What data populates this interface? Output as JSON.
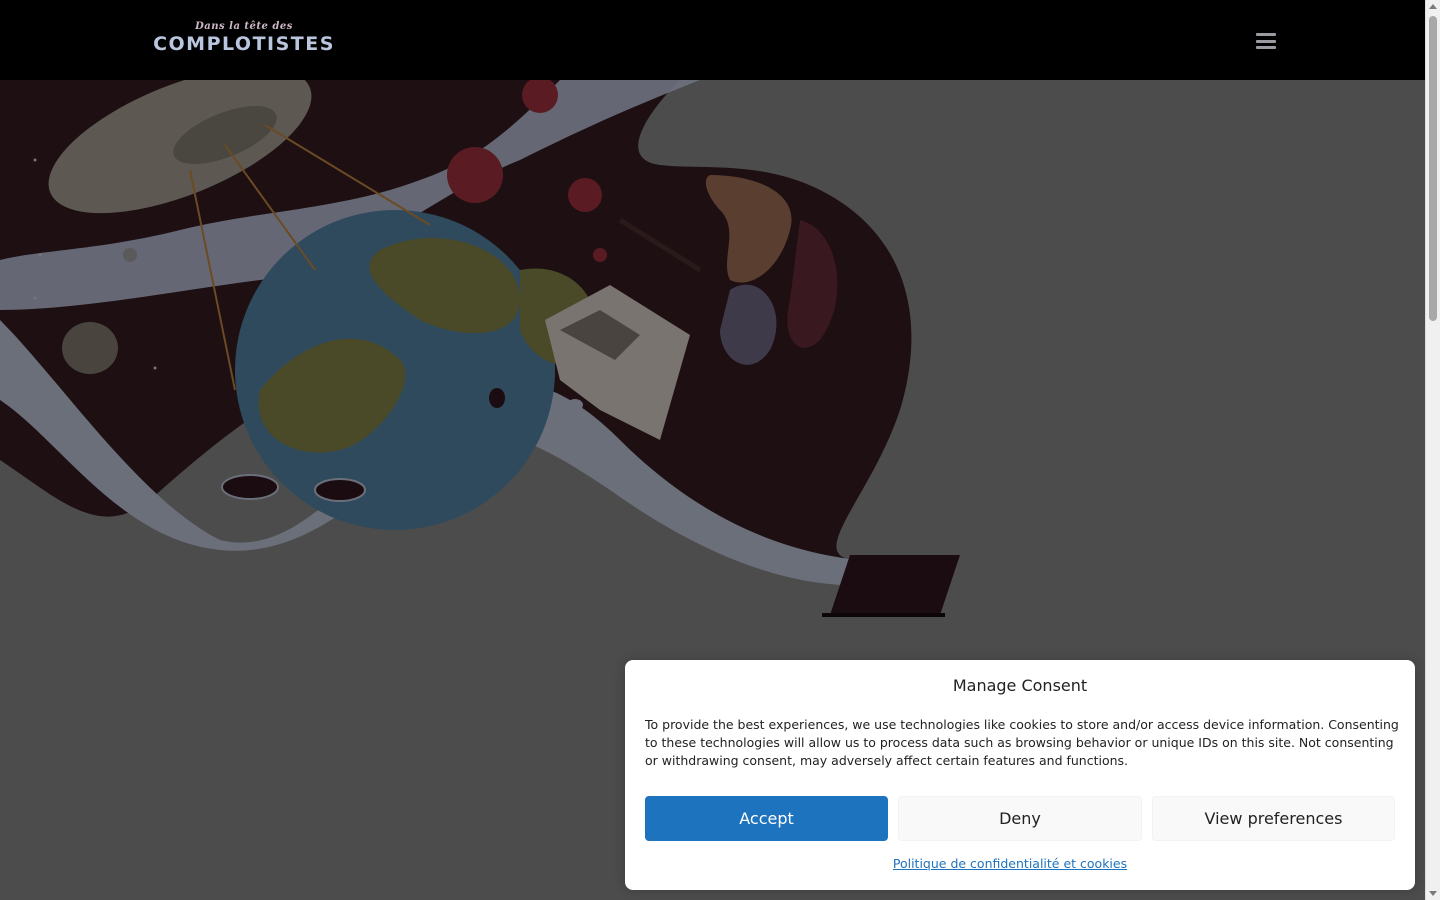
{
  "header": {
    "logo_top": "Dans la tête des",
    "logo_main": "COMPLOTISTES",
    "menu_icon": "hamburger-menu-icon"
  },
  "hero": {
    "illustration": "conspiracy-theories-illustration"
  },
  "consent": {
    "title": "Manage Consent",
    "text": "To provide the best experiences, we use technologies like cookies to store and/or access device information. Consenting to these technologies will allow us to process data such as browsing behavior or unique IDs on this site. Not consenting or withdrawing consent, may adversely affect certain features and functions.",
    "accept_label": "Accept",
    "deny_label": "Deny",
    "preferences_label": "View preferences",
    "policy_link": "Politique de confidentialité et cookies"
  },
  "colors": {
    "header_bg": "#000000",
    "overlay_bg": "#4c4c4c",
    "accent": "#1e73be"
  }
}
